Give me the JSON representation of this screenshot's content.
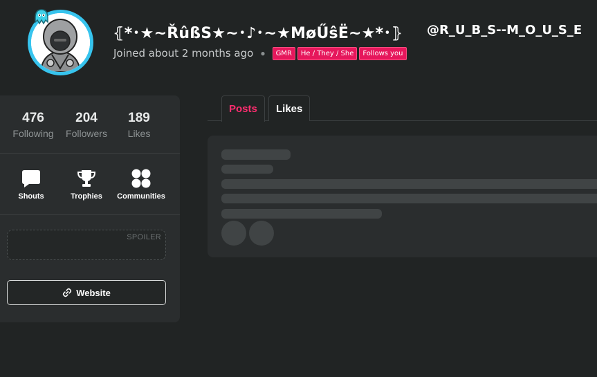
{
  "profile": {
    "display_name": "⦃*･★~ŘûßS★~･♪･~★MøŰŝË~★*･⦄",
    "username": "@R_U_B_S--M_O_U_S_E",
    "joined": "Joined about 2 months ago",
    "tags": [
      "GMR",
      "He / They / She",
      "Follows you"
    ],
    "avatar": "hooded-character-avatar",
    "colors": {
      "avatar_ring": "#37c4ee",
      "tag_bg": "#e6175c",
      "accent": "#ff2d6f",
      "background": "#212424",
      "panel": "#2a2d2e"
    }
  },
  "stats": [
    {
      "value": "476",
      "label": "Following"
    },
    {
      "value": "204",
      "label": "Followers"
    },
    {
      "value": "189",
      "label": "Likes"
    }
  ],
  "shortcuts": [
    {
      "label": "Shouts",
      "icon": "speech-bubble-icon"
    },
    {
      "label": "Trophies",
      "icon": "trophy-icon"
    },
    {
      "label": "Communities",
      "icon": "communities-icon"
    }
  ],
  "spoiler": {
    "label": "SPOILER"
  },
  "website": {
    "label": "Website",
    "icon": "link-icon"
  },
  "tabs": [
    {
      "label": "Posts",
      "active": true
    },
    {
      "label": "Likes",
      "active": false
    }
  ]
}
